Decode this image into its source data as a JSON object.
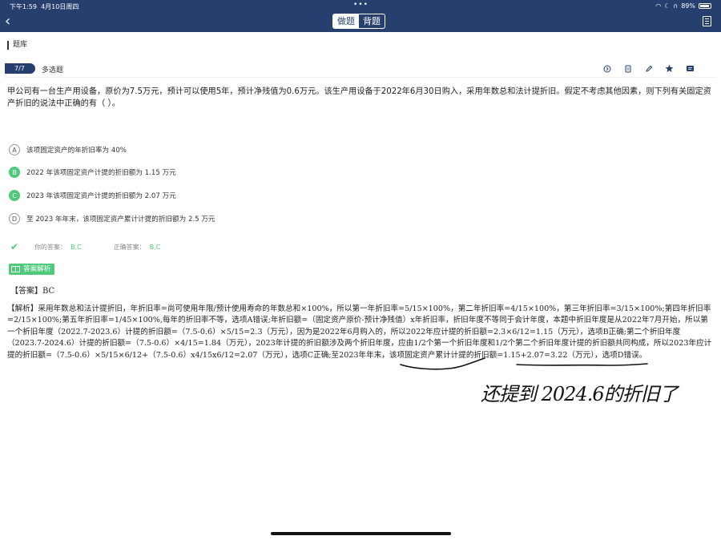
{
  "status": {
    "time": "下午1:59",
    "date": "4月10日周四",
    "battery": "89%"
  },
  "nav": {
    "tab_practice": "做题",
    "tab_memorize": "背题"
  },
  "breadcrumb": "题库",
  "question": {
    "number": "7/7",
    "type": "多选题",
    "text": "甲公司有一台生产用设备，原价为7.5万元，预计可以使用5年，预计净残值为0.6万元。该生产用设备于2022年6月30日购入，采用年数总和法计提折旧。假定不考虑其他因素，则下列有关固定资产折旧的说法中正确的有（  ）。"
  },
  "options": [
    {
      "key": "A",
      "text": "该项固定资产的年折旧率为 40%",
      "correct": false
    },
    {
      "key": "B",
      "text": "2022 年该项固定资产计提的折旧额为 1.15 万元",
      "correct": true
    },
    {
      "key": "C",
      "text": "2023 年该项固定资产计提的折旧额为 2.07 万元",
      "correct": true
    },
    {
      "key": "D",
      "text": "至 2023 年年末，该项固定资产累计计提的折旧额为 2.5 万元",
      "correct": false
    }
  ],
  "result": {
    "your_label": "你的答案：",
    "your_value": "B,C",
    "correct_label": "正确答案：",
    "correct_value": "B,C"
  },
  "analysis": {
    "badge": "答案解析",
    "answer": "【答案】BC",
    "text": "【解析】采用年数总和法计提折旧，年折旧率=尚可使用年限/预计使用寿命的年数总和×100%，所以第一年折旧率=5/15×100%，第二年折旧率=4/15×100%，第三年折旧率=3/15×100%;第四年折旧率=2/15×100%;第五年折旧率=1/45×100%,每年的折旧率不等，选项A错误;年折旧额=（固定资产原价-预计净残值）x年折旧率，折旧年度不等同于会计年度，本题中折旧年度是从2022年7月开始，所以第一个折旧年度（2022.7-2023.6）计提的折旧额=（7.5-0.6）×5/15=2.3（万元），因为是2022年6月购入的，所以2022年应计提的折旧额=2.3×6/12=1.15（万元），选项B正确;第二个折旧年度（2023.7-2024.6）计提的折旧额=（7.5-0.6）×4/15=1.84（万元），2023年计提的折旧额涉及两个折旧年度，应由1/2个第一个折旧年度和1/2个第二个折旧年度计提的折旧额共同构成，所以2023年应计提的折旧额=（7.5-0.6）×5/15×6/12+（7.5-0.6）x4/15x6/12=2.07（万元），选项C正确;至2023年年末，该项固定资产累计计提的折旧额=1.15+2.07=3.22（万元），选项D错误。"
  },
  "handwriting": "还提到 2024.6的折旧了"
}
